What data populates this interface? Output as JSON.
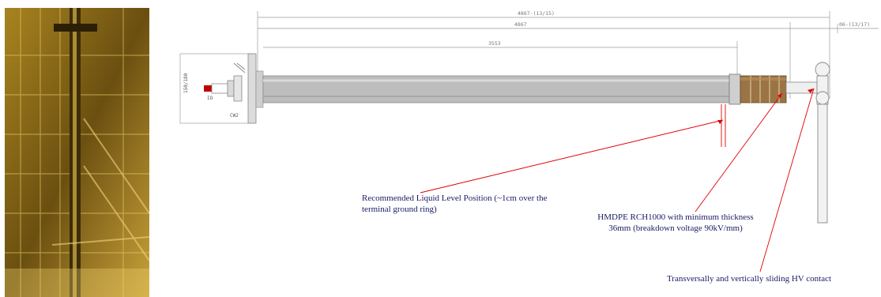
{
  "photo": {
    "icon": "detector-interior-photo"
  },
  "drawing": {
    "dimensions": {
      "overall_top": "4867-(13/15)",
      "overall_second": "4867",
      "inner_length": "3553",
      "right_offset": "06-(13/17)",
      "flange_height": "150/180"
    },
    "labels": {
      "connector_tag": "IO",
      "flange_tag": "CW2"
    },
    "colors": {
      "annotation_line": "#e00000",
      "annotation_text": "#1a1a66",
      "tube": "#b9b9b9",
      "ring_brown": "#8b6a3a"
    }
  },
  "annotations": {
    "liquid_level": "Recommended Liquid Level Position (~1cm over the terminal ground ring)",
    "hmdpe": "HMDPE RCH1000 with minimum thickness 36mm (breakdown voltage 90kV/mm)",
    "hv_contact": "Transversally and vertically sliding HV contact"
  }
}
